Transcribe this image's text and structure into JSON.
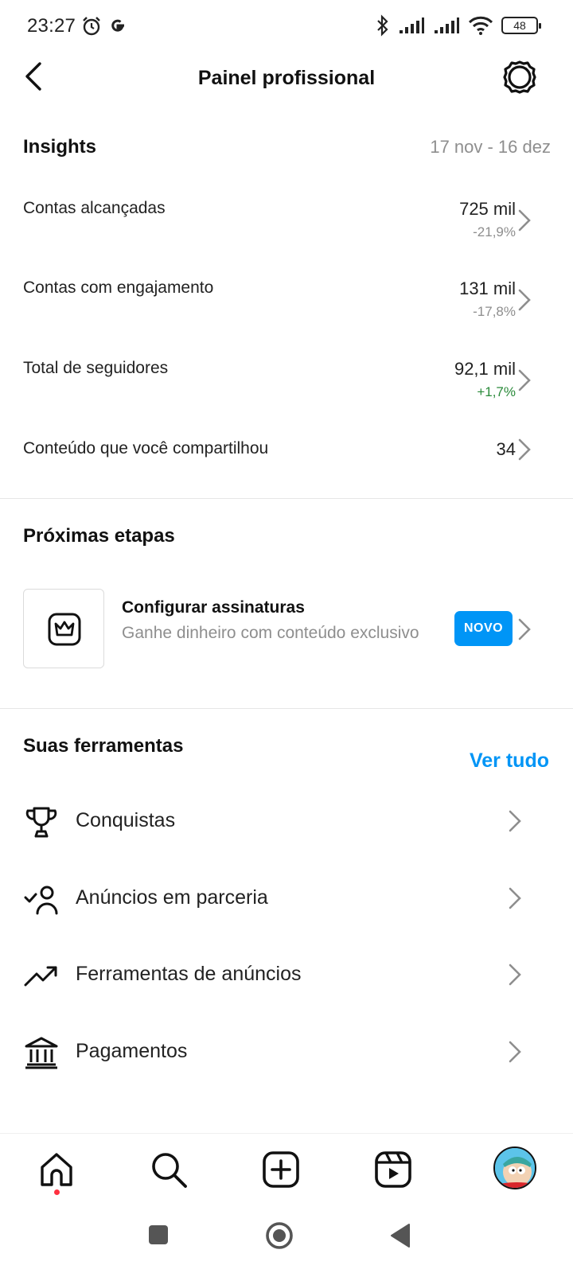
{
  "status": {
    "time": "23:27",
    "battery": "48"
  },
  "header": {
    "title": "Painel profissional"
  },
  "insights": {
    "title": "Insights",
    "date_range": "17 nov - 16 dez",
    "rows": [
      {
        "label": "Contas alcançadas",
        "value": "725 mil",
        "change": "-21,9%"
      },
      {
        "label": "Contas com engajamento",
        "value": "131 mil",
        "change": "-17,8%"
      },
      {
        "label": "Total de seguidores",
        "value": "92,1 mil",
        "change": "+1,7%"
      },
      {
        "label": "Conteúdo que você compartilhou",
        "value": "34"
      }
    ]
  },
  "next_steps": {
    "title": "Próximas etapas",
    "card": {
      "title": "Configurar assinaturas",
      "subtitle": "Ganhe dinheiro com conteúdo exclusivo",
      "badge": "NOVO"
    }
  },
  "tools": {
    "title": "Suas ferramentas",
    "see_all": "Ver tudo",
    "items": [
      {
        "label": "Conquistas",
        "icon": "trophy-icon"
      },
      {
        "label": "Anúncios em parceria",
        "icon": "partner-ads-icon"
      },
      {
        "label": "Ferramentas de anúncios",
        "icon": "trending-up-icon"
      },
      {
        "label": "Pagamentos",
        "icon": "bank-icon"
      }
    ]
  },
  "nav": {
    "items": [
      "home-icon",
      "search-icon",
      "create-icon",
      "reels-icon",
      "profile-avatar"
    ]
  },
  "colors": {
    "accent": "#0095f6",
    "positive": "#2a8a3a",
    "muted": "#8e8e8e"
  }
}
